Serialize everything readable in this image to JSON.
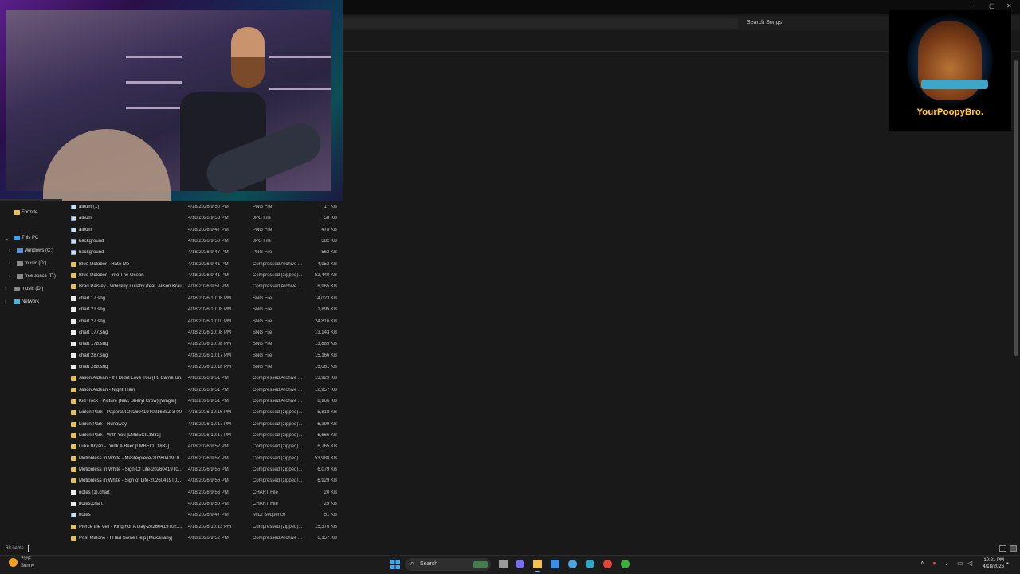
{
  "window": {
    "search_placeholder": "Search Songs",
    "min": "–",
    "max": "▢",
    "close": "✕"
  },
  "logo": {
    "text": "YourPoopyBro."
  },
  "nav": {
    "items": [
      {
        "label": "Fortnite",
        "icon": "folder-icon"
      },
      {
        "label": "This PC",
        "icon": "computer-icon"
      },
      {
        "label": "Windows (C:)",
        "icon": "drive-icon"
      },
      {
        "label": "music (D:)",
        "icon": "drive-icon"
      },
      {
        "label": "free space (F:)",
        "icon": "drive-icon"
      },
      {
        "label": "music (D:)",
        "icon": "drive-icon"
      },
      {
        "label": "Network",
        "icon": "network-icon"
      }
    ]
  },
  "files": [
    {
      "name": "album (1)",
      "date": "4/18/2026 9:50 PM",
      "type": "PNG File",
      "size": "17 KB",
      "kind": "img"
    },
    {
      "name": "album",
      "date": "4/18/2026 9:53 PM",
      "type": "JPG File",
      "size": "58 KB",
      "kind": "img"
    },
    {
      "name": "album",
      "date": "4/18/2026 9:47 PM",
      "type": "PNG File",
      "size": "478 KB",
      "kind": "img"
    },
    {
      "name": "background",
      "date": "4/18/2026 9:50 PM",
      "type": "JPG File",
      "size": "382 KB",
      "kind": "img"
    },
    {
      "name": "background",
      "date": "4/18/2026 9:47 PM",
      "type": "PNG File",
      "size": "563 KB",
      "kind": "img"
    },
    {
      "name": "Blue October - Hate Me",
      "date": "4/18/2026 9:41 PM",
      "type": "Compressed Archive ...",
      "size": "4,952 KB",
      "kind": "fold"
    },
    {
      "name": "Blue October - Into The Ocean",
      "date": "4/18/2026 9:41 PM",
      "type": "Compressed (zipped)...",
      "size": "52,440 KB",
      "kind": "fold"
    },
    {
      "name": "Brad Paisley - Whiskey Lullaby (feat. Alison Krau...",
      "date": "4/18/2026 9:51 PM",
      "type": "Compressed Archive ...",
      "size": "8,965 KB",
      "kind": "fold"
    },
    {
      "name": "chart 17.sng",
      "date": "4/18/2026 10:08 PM",
      "type": "SNG File",
      "size": "14,023 KB",
      "kind": "doc"
    },
    {
      "name": "chart 21.sng",
      "date": "4/18/2026 10:08 PM",
      "type": "SNG File",
      "size": "1,895 KB",
      "kind": "doc"
    },
    {
      "name": "chart 27.sng",
      "date": "4/18/2026 10:10 PM",
      "type": "SNG File",
      "size": "24,816 KB",
      "kind": "doc"
    },
    {
      "name": "chart 177.sng",
      "date": "4/18/2026 10:08 PM",
      "type": "SNG File",
      "size": "13,143 KB",
      "kind": "doc"
    },
    {
      "name": "chart 178.sng",
      "date": "4/18/2026 10:08 PM",
      "type": "SNG File",
      "size": "13,889 KB",
      "kind": "doc"
    },
    {
      "name": "chart 287.sng",
      "date": "4/18/2026 10:17 PM",
      "type": "SNG File",
      "size": "15,166 KB",
      "kind": "doc"
    },
    {
      "name": "chart 288.sng",
      "date": "4/18/2026 10:18 PM",
      "type": "SNG File",
      "size": "15,061 KB",
      "kind": "doc"
    },
    {
      "name": "Jason Aldean - If I Didnt Love You (Ft. Carrie Un...",
      "date": "4/18/2026 9:51 PM",
      "type": "Compressed Archive ...",
      "size": "13,929 KB",
      "kind": "fold"
    },
    {
      "name": "Jason Aldean - Night Train",
      "date": "4/18/2026 9:51 PM",
      "type": "Compressed Archive ...",
      "size": "12,957 KB",
      "kind": "fold"
    },
    {
      "name": "Kid Rock - Picture (feat. Sheryl Crow) [Wagsii]",
      "date": "4/18/2026 9:51 PM",
      "type": "Compressed Archive ...",
      "size": "8,966 KB",
      "kind": "fold"
    },
    {
      "name": "Linkin Park - Papercut-20260419T021638Z-3-001",
      "date": "4/18/2026 10:16 PM",
      "type": "Compressed (zipped)...",
      "size": "5,818 KB",
      "kind": "fold"
    },
    {
      "name": "Linkin Park - Runaway",
      "date": "4/18/2026 10:17 PM",
      "type": "Compressed (zipped)...",
      "size": "6,399 KB",
      "kind": "fold"
    },
    {
      "name": "Linkin Park - With You [LMBECIL1832]",
      "date": "4/18/2026 10:17 PM",
      "type": "Compressed (zipped)...",
      "size": "6,666 KB",
      "kind": "fold"
    },
    {
      "name": "Luke Bryan - Drink A Beer [LMBECIL1832]",
      "date": "4/18/2026 9:52 PM",
      "type": "Compressed (zipped)...",
      "size": "6,765 KB",
      "kind": "fold"
    },
    {
      "name": "Motionless In White - Masterpiece-20260419T0...",
      "date": "4/18/2026 9:57 PM",
      "type": "Compressed (zipped)...",
      "size": "53,988 KB",
      "kind": "fold"
    },
    {
      "name": "Motionless In White - Sign Of Life-20260419T0...",
      "date": "4/18/2026 9:55 PM",
      "type": "Compressed (zipped)...",
      "size": "6,079 KB",
      "kind": "fold"
    },
    {
      "name": "Motionless in White - Sign of Life-20260419T0...",
      "date": "4/18/2026 9:56 PM",
      "type": "Compressed (zipped)...",
      "size": "6,929 KB",
      "kind": "fold"
    },
    {
      "name": "notes (1).chart",
      "date": "4/18/2026 9:53 PM",
      "type": "CHART File",
      "size": "20 KB",
      "kind": "doc"
    },
    {
      "name": "notes.chart",
      "date": "4/18/2026 9:50 PM",
      "type": "CHART File",
      "size": "29 KB",
      "kind": "doc"
    },
    {
      "name": "notes",
      "date": "4/18/2026 9:47 PM",
      "type": "MIDI Sequence",
      "size": "51 KB",
      "kind": "img"
    },
    {
      "name": "Pierce the Veil - King For A Day-20260419T021...",
      "date": "4/18/2026 10:13 PM",
      "type": "Compressed (zipped)...",
      "size": "15,376 KB",
      "kind": "fold"
    },
    {
      "name": "Post Malone - I Had Some Help [Miscellany]",
      "date": "4/18/2026 9:52 PM",
      "type": "Compressed Archive ...",
      "size": "6,157 KB",
      "kind": "fold"
    }
  ],
  "status": {
    "count": "68 items"
  },
  "taskbar": {
    "weather_temp": "73°F",
    "weather_desc": "Sunny",
    "search_label": "Search",
    "time": "10:21 PM",
    "date": "4/18/2026",
    "apps": [
      {
        "icon": "task-view-icon",
        "color": "#9a9a9a"
      },
      {
        "icon": "copilot-icon",
        "color": "#7b6cf0"
      },
      {
        "icon": "file-explorer-icon",
        "color": "#f2c14e"
      },
      {
        "icon": "store-icon",
        "color": "#3a8ee6"
      },
      {
        "icon": "magnifier-app-icon",
        "color": "#4aa3df"
      },
      {
        "icon": "edge-icon",
        "color": "#2fa9c9"
      },
      {
        "icon": "chrome-icon",
        "color": "#e0463b"
      },
      {
        "icon": "xbox-icon",
        "color": "#3fae3f"
      }
    ]
  }
}
